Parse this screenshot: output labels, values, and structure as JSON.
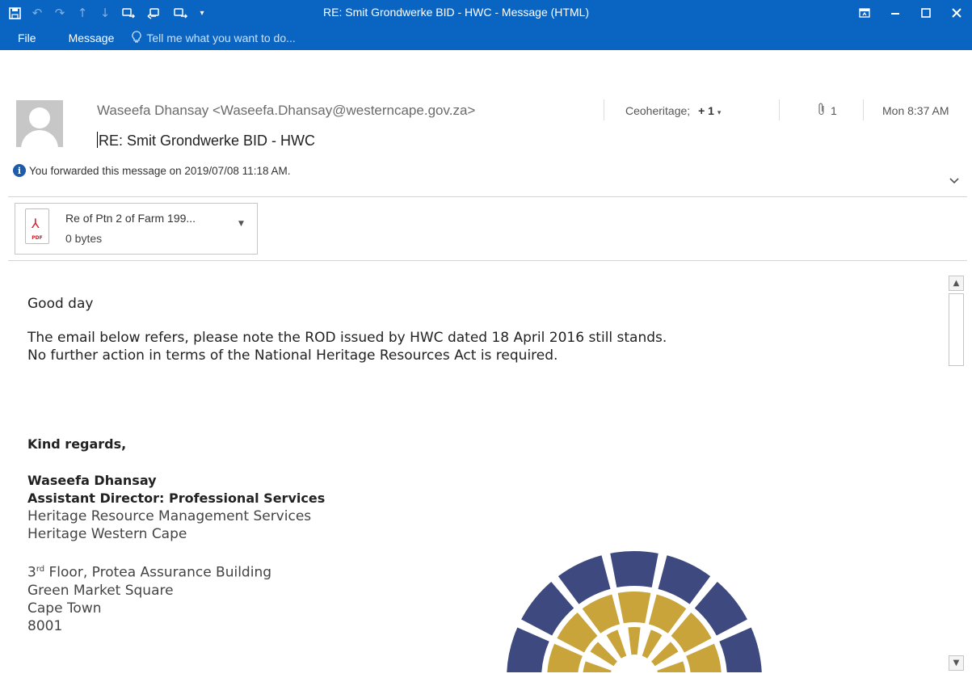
{
  "window": {
    "title": "RE: Smit Grondwerke BID - HWC - Message (HTML)",
    "controls": [
      "restore-ribbon-icon",
      "minimize-icon",
      "maximize-icon",
      "close-icon"
    ]
  },
  "qat_icons": [
    "save-icon",
    "undo-icon",
    "redo-icon",
    "up-icon",
    "down-icon",
    "reply-icon",
    "reply-all-icon",
    "forward-icon",
    "customize-icon"
  ],
  "ribbon": {
    "tabs": [
      "File",
      "Message"
    ],
    "tell_me": "Tell me what you want to do..."
  },
  "header": {
    "from": "Waseefa Dhansay <Waseefa.Dhansay@westerncape.gov.za>",
    "to": "Ceoheritage;",
    "to_more": "+ 1",
    "attachment_count": "1",
    "date": "Mon 8:37 AM",
    "subject": "RE: Smit Grondwerke BID - HWC",
    "info": "You forwarded this message on 2019/07/08 11:18 AM."
  },
  "attachment": {
    "name": "Re of Ptn 2 of Farm 199...",
    "size": "0 bytes",
    "type_label": "PDF"
  },
  "body": {
    "greeting": "Good day",
    "line1": "The email below refers, please note the ROD issued by HWC dated 18 April 2016 still stands.",
    "line2": "No further action in terms of the National Heritage Resources Act is required.",
    "closing": "Kind regards,",
    "sig_name": "Waseefa Dhansay",
    "sig_title": "Assistant Director: Professional Services",
    "sig_dept": "Heritage Resource Management Services",
    "sig_org": "Heritage Western Cape",
    "addr_floor_num": "3",
    "addr_floor_sup": "rd",
    "addr_floor_rest": " Floor, Protea Assurance Building",
    "addr_street": "Green Market Square",
    "addr_city": "Cape Town",
    "addr_code": "8001"
  },
  "colors": {
    "titlebar": "#0a64c2",
    "logo_blue": "#3e4a7f",
    "logo_gold": "#c9a43a"
  }
}
